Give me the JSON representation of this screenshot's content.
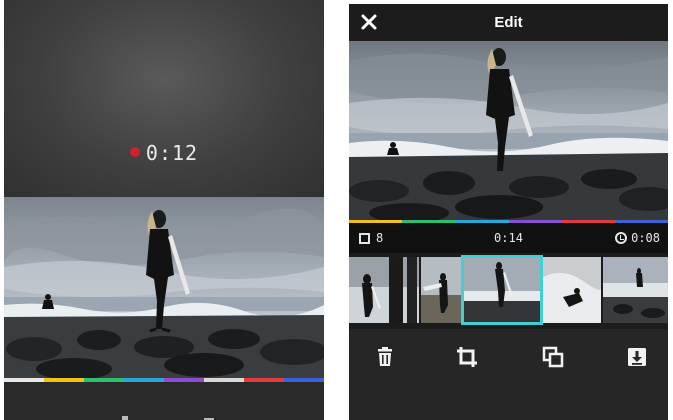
{
  "left_screen": {
    "recording_time": "0:12",
    "rainbow_colors": [
      "#e8e8e8",
      "#f2c21b",
      "#2fbf6a",
      "#2aa7d8",
      "#8a4fd1",
      "#d8d8d8",
      "#e23b3b",
      "#3b63d6"
    ]
  },
  "right_screen": {
    "header": {
      "title": "Edit",
      "close_icon": "close-icon"
    },
    "info_bar": {
      "clip_count": "8",
      "clip_time": "0:14",
      "total_time": "0:08"
    },
    "rainbow_colors": [
      "#f2c21b",
      "#2fbf6a",
      "#2aa7d8",
      "#8a4fd1",
      "#e23b3b",
      "#3b63d6"
    ],
    "accent_color": "#3fd0d6",
    "toolbar": {
      "icons": [
        "trash-icon",
        "crop-icon",
        "duplicate-icon",
        "download-icon"
      ]
    }
  }
}
